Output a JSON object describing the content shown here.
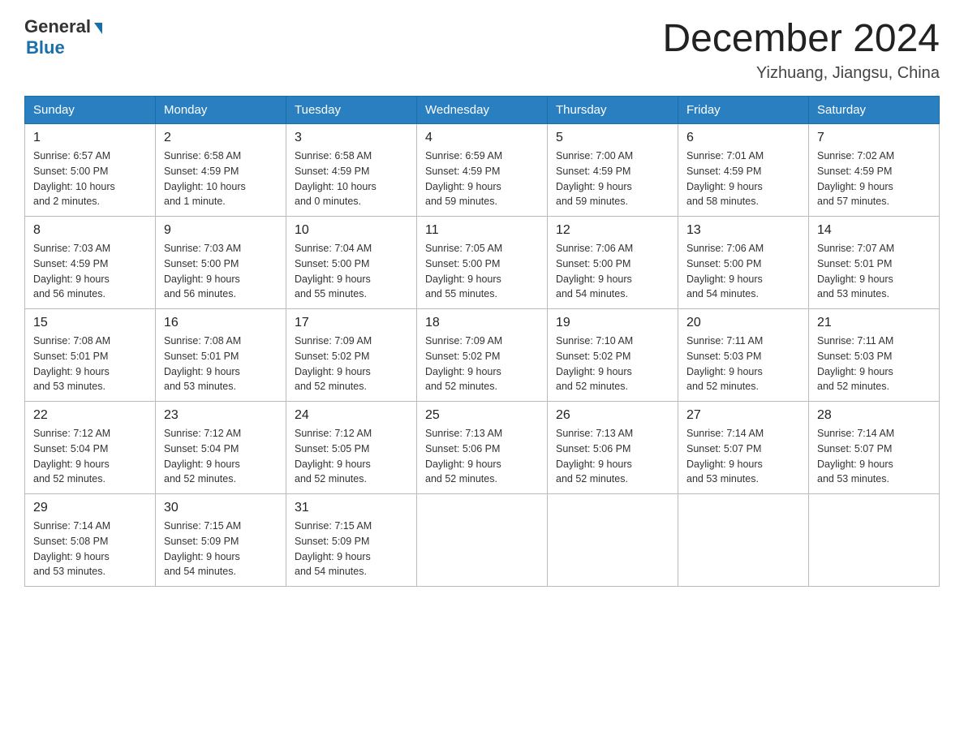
{
  "header": {
    "logo_general": "General",
    "logo_blue": "Blue",
    "month_title": "December 2024",
    "location": "Yizhuang, Jiangsu, China"
  },
  "days_of_week": [
    "Sunday",
    "Monday",
    "Tuesday",
    "Wednesday",
    "Thursday",
    "Friday",
    "Saturday"
  ],
  "weeks": [
    [
      {
        "day": "1",
        "sunrise": "6:57 AM",
        "sunset": "5:00 PM",
        "daylight": "10 hours and 2 minutes."
      },
      {
        "day": "2",
        "sunrise": "6:58 AM",
        "sunset": "4:59 PM",
        "daylight": "10 hours and 1 minute."
      },
      {
        "day": "3",
        "sunrise": "6:58 AM",
        "sunset": "4:59 PM",
        "daylight": "10 hours and 0 minutes."
      },
      {
        "day": "4",
        "sunrise": "6:59 AM",
        "sunset": "4:59 PM",
        "daylight": "9 hours and 59 minutes."
      },
      {
        "day": "5",
        "sunrise": "7:00 AM",
        "sunset": "4:59 PM",
        "daylight": "9 hours and 59 minutes."
      },
      {
        "day": "6",
        "sunrise": "7:01 AM",
        "sunset": "4:59 PM",
        "daylight": "9 hours and 58 minutes."
      },
      {
        "day": "7",
        "sunrise": "7:02 AM",
        "sunset": "4:59 PM",
        "daylight": "9 hours and 57 minutes."
      }
    ],
    [
      {
        "day": "8",
        "sunrise": "7:03 AM",
        "sunset": "4:59 PM",
        "daylight": "9 hours and 56 minutes."
      },
      {
        "day": "9",
        "sunrise": "7:03 AM",
        "sunset": "5:00 PM",
        "daylight": "9 hours and 56 minutes."
      },
      {
        "day": "10",
        "sunrise": "7:04 AM",
        "sunset": "5:00 PM",
        "daylight": "9 hours and 55 minutes."
      },
      {
        "day": "11",
        "sunrise": "7:05 AM",
        "sunset": "5:00 PM",
        "daylight": "9 hours and 55 minutes."
      },
      {
        "day": "12",
        "sunrise": "7:06 AM",
        "sunset": "5:00 PM",
        "daylight": "9 hours and 54 minutes."
      },
      {
        "day": "13",
        "sunrise": "7:06 AM",
        "sunset": "5:00 PM",
        "daylight": "9 hours and 54 minutes."
      },
      {
        "day": "14",
        "sunrise": "7:07 AM",
        "sunset": "5:01 PM",
        "daylight": "9 hours and 53 minutes."
      }
    ],
    [
      {
        "day": "15",
        "sunrise": "7:08 AM",
        "sunset": "5:01 PM",
        "daylight": "9 hours and 53 minutes."
      },
      {
        "day": "16",
        "sunrise": "7:08 AM",
        "sunset": "5:01 PM",
        "daylight": "9 hours and 53 minutes."
      },
      {
        "day": "17",
        "sunrise": "7:09 AM",
        "sunset": "5:02 PM",
        "daylight": "9 hours and 52 minutes."
      },
      {
        "day": "18",
        "sunrise": "7:09 AM",
        "sunset": "5:02 PM",
        "daylight": "9 hours and 52 minutes."
      },
      {
        "day": "19",
        "sunrise": "7:10 AM",
        "sunset": "5:02 PM",
        "daylight": "9 hours and 52 minutes."
      },
      {
        "day": "20",
        "sunrise": "7:11 AM",
        "sunset": "5:03 PM",
        "daylight": "9 hours and 52 minutes."
      },
      {
        "day": "21",
        "sunrise": "7:11 AM",
        "sunset": "5:03 PM",
        "daylight": "9 hours and 52 minutes."
      }
    ],
    [
      {
        "day": "22",
        "sunrise": "7:12 AM",
        "sunset": "5:04 PM",
        "daylight": "9 hours and 52 minutes."
      },
      {
        "day": "23",
        "sunrise": "7:12 AM",
        "sunset": "5:04 PM",
        "daylight": "9 hours and 52 minutes."
      },
      {
        "day": "24",
        "sunrise": "7:12 AM",
        "sunset": "5:05 PM",
        "daylight": "9 hours and 52 minutes."
      },
      {
        "day": "25",
        "sunrise": "7:13 AM",
        "sunset": "5:06 PM",
        "daylight": "9 hours and 52 minutes."
      },
      {
        "day": "26",
        "sunrise": "7:13 AM",
        "sunset": "5:06 PM",
        "daylight": "9 hours and 52 minutes."
      },
      {
        "day": "27",
        "sunrise": "7:14 AM",
        "sunset": "5:07 PM",
        "daylight": "9 hours and 53 minutes."
      },
      {
        "day": "28",
        "sunrise": "7:14 AM",
        "sunset": "5:07 PM",
        "daylight": "9 hours and 53 minutes."
      }
    ],
    [
      {
        "day": "29",
        "sunrise": "7:14 AM",
        "sunset": "5:08 PM",
        "daylight": "9 hours and 53 minutes."
      },
      {
        "day": "30",
        "sunrise": "7:15 AM",
        "sunset": "5:09 PM",
        "daylight": "9 hours and 54 minutes."
      },
      {
        "day": "31",
        "sunrise": "7:15 AM",
        "sunset": "5:09 PM",
        "daylight": "9 hours and 54 minutes."
      },
      null,
      null,
      null,
      null
    ]
  ]
}
